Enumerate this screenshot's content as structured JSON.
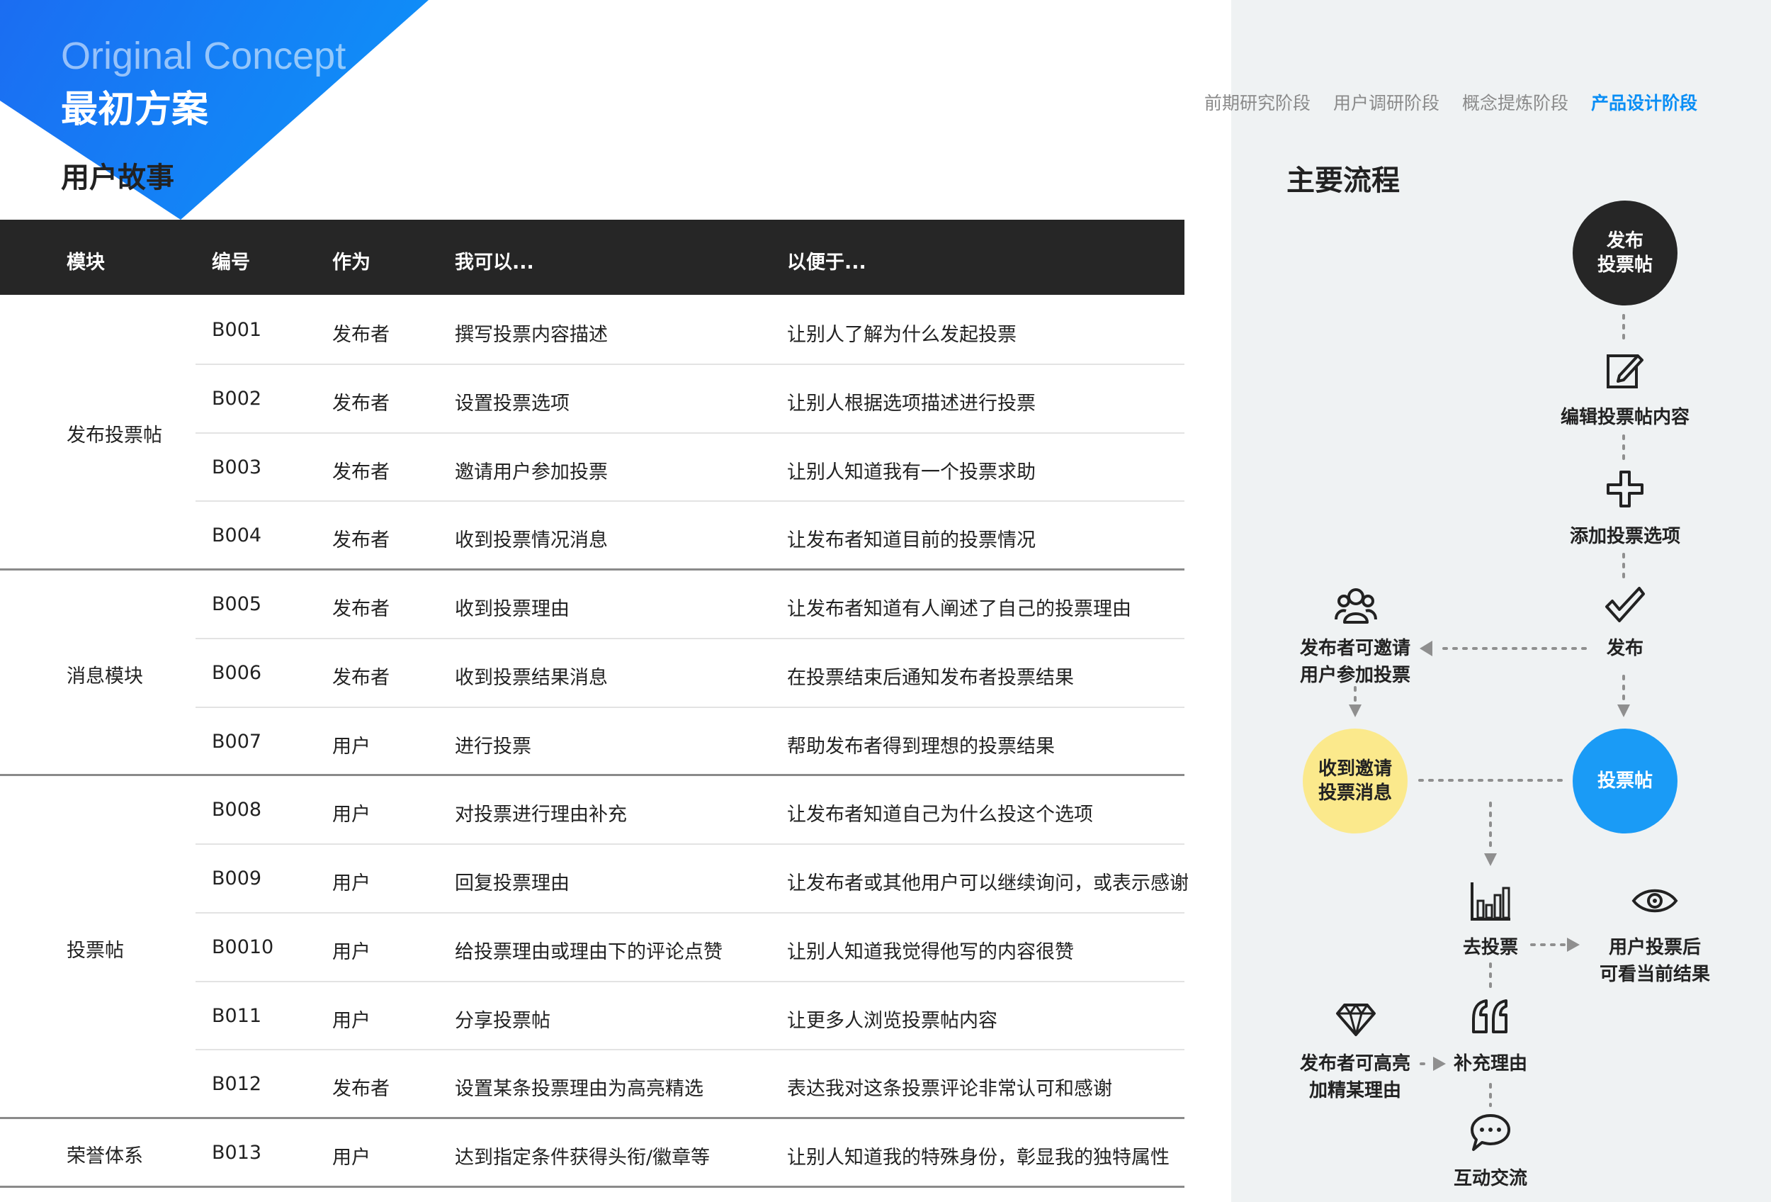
{
  "header": {
    "concept_en": "Original Concept",
    "concept_cn": "最初方案",
    "section_title": "用户故事",
    "accent_color": "#1577f6"
  },
  "nav": {
    "items": [
      "前期研究阶段",
      "用户调研阶段",
      "概念提炼阶段",
      "产品设计阶段"
    ],
    "active": "产品设计阶段"
  },
  "table": {
    "columns": [
      "模块",
      "编号",
      "作为",
      "我可以...",
      "以便于..."
    ],
    "modules": [
      "发布投票帖",
      "消息模块",
      "投票帖",
      "荣誉体系"
    ],
    "rows": [
      {
        "id": "B001",
        "role": "发布者",
        "action": "撰写投票内容描述",
        "purpose": "让别人了解为什么发起投票"
      },
      {
        "id": "B002",
        "role": "发布者",
        "action": "设置投票选项",
        "purpose": "让别人根据选项描述进行投票"
      },
      {
        "id": "B003",
        "role": "发布者",
        "action": "邀请用户参加投票",
        "purpose": "让别人知道我有一个投票求助"
      },
      {
        "id": "B004",
        "role": "发布者",
        "action": "收到投票情况消息",
        "purpose": "让发布者知道目前的投票情况"
      },
      {
        "id": "B005",
        "role": "发布者",
        "action": "收到投票理由",
        "purpose": "让发布者知道有人阐述了自己的投票理由"
      },
      {
        "id": "B006",
        "role": "发布者",
        "action": "收到投票结果消息",
        "purpose": "在投票结束后通知发布者投票结果"
      },
      {
        "id": "B007",
        "role": "用户",
        "action": "进行投票",
        "purpose": "帮助发布者得到理想的投票结果"
      },
      {
        "id": "B008",
        "role": "用户",
        "action": "对投票进行理由补充",
        "purpose": "让发布者知道自己为什么投这个选项"
      },
      {
        "id": "B009",
        "role": "用户",
        "action": "回复投票理由",
        "purpose": "让发布者或其他用户可以继续询问，或表示感谢"
      },
      {
        "id": "B0010",
        "role": "用户",
        "action": "给投票理由或理由下的评论点赞",
        "purpose": "让别人知道我觉得他写的内容很赞"
      },
      {
        "id": "B011",
        "role": "用户",
        "action": "分享投票帖",
        "purpose": "让更多人浏览投票帖内容"
      },
      {
        "id": "B012",
        "role": "发布者",
        "action": "设置某条投票理由为高亮精选",
        "purpose": "表达我对这条投票评论非常认可和感谢"
      },
      {
        "id": "B013",
        "role": "用户",
        "action": "达到指定条件获得头衔/徽章等",
        "purpose": "让别人知道我的特殊身份，彰显我的独特属性"
      }
    ]
  },
  "flow": {
    "title": "主要流程",
    "start_node": "发布\n投票帖",
    "edit": "编辑投票帖内容",
    "add_option": "添加投票选项",
    "publish": "发布",
    "invite": "发布者可邀请\n用户参加投票",
    "invite_msg_node": "收到邀请\n投票消息",
    "post_node": "投票帖",
    "go_vote": "去投票",
    "view_result": "用户投票后\n可看当前结果",
    "supplement": "补充理由",
    "highlight": "发布者可高亮\n加精某理由",
    "interact": "互动交流",
    "colors": {
      "start": "#262626",
      "invite_msg": "#fbe98c",
      "post": "#1a9bf6",
      "arrow": "#8f8f8f"
    },
    "icons": [
      "edit-icon",
      "plus-icon",
      "check-icon",
      "users-icon",
      "bar-chart-icon",
      "eye-icon",
      "quote-icon",
      "diamond-icon",
      "chat-icon"
    ]
  }
}
